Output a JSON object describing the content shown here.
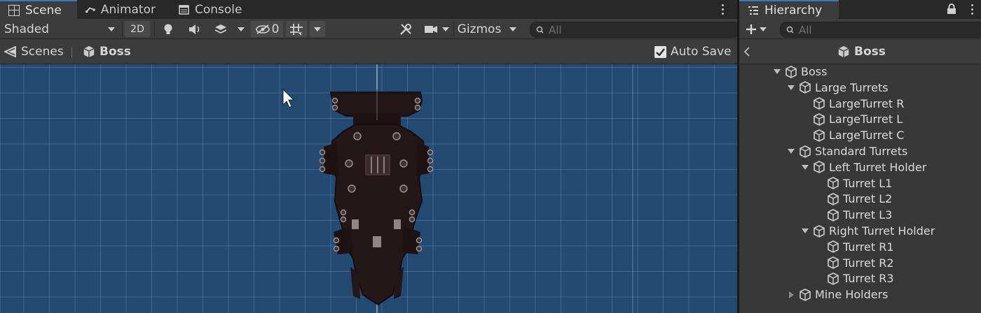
{
  "scene_tabs": [
    {
      "label": "Scene",
      "icon": "grid-icon",
      "active": true
    },
    {
      "label": "Animator",
      "icon": "animator-icon",
      "active": false
    },
    {
      "label": "Console",
      "icon": "console-icon",
      "active": false
    }
  ],
  "toolbar": {
    "draw_mode": "Shaded",
    "two_d": "2D",
    "hidden_count": "0",
    "gizmos": "Gizmos",
    "search_placeholder": "All"
  },
  "breadcrumb": {
    "scenes": "Scenes",
    "current": "Boss",
    "auto_save": "Auto Save",
    "auto_save_checked": true
  },
  "hierarchy": {
    "title": "Hierarchy",
    "search_placeholder": "All",
    "prefab_title": "Boss",
    "items": [
      {
        "label": "Boss",
        "depth": 0,
        "fold": "open"
      },
      {
        "label": "Large Turrets",
        "depth": 1,
        "fold": "open"
      },
      {
        "label": "LargeTurret R",
        "depth": 2,
        "fold": "none"
      },
      {
        "label": "LargeTurret L",
        "depth": 2,
        "fold": "none"
      },
      {
        "label": "LargeTurret C",
        "depth": 2,
        "fold": "none"
      },
      {
        "label": "Standard Turrets",
        "depth": 1,
        "fold": "open"
      },
      {
        "label": "Left Turret Holder",
        "depth": 2,
        "fold": "open"
      },
      {
        "label": "Turret L1",
        "depth": 3,
        "fold": "none"
      },
      {
        "label": "Turret L2",
        "depth": 3,
        "fold": "none"
      },
      {
        "label": "Turret L3",
        "depth": 3,
        "fold": "none"
      },
      {
        "label": "Right Turret Holder",
        "depth": 2,
        "fold": "open"
      },
      {
        "label": "Turret R1",
        "depth": 3,
        "fold": "none"
      },
      {
        "label": "Turret R2",
        "depth": 3,
        "fold": "none"
      },
      {
        "label": "Turret R3",
        "depth": 3,
        "fold": "none"
      },
      {
        "label": "Mine Holders",
        "depth": 1,
        "fold": "closed"
      }
    ]
  },
  "colors": {
    "viewport": "#234a72",
    "panel": "#383838",
    "accent": "#3a79bb"
  }
}
